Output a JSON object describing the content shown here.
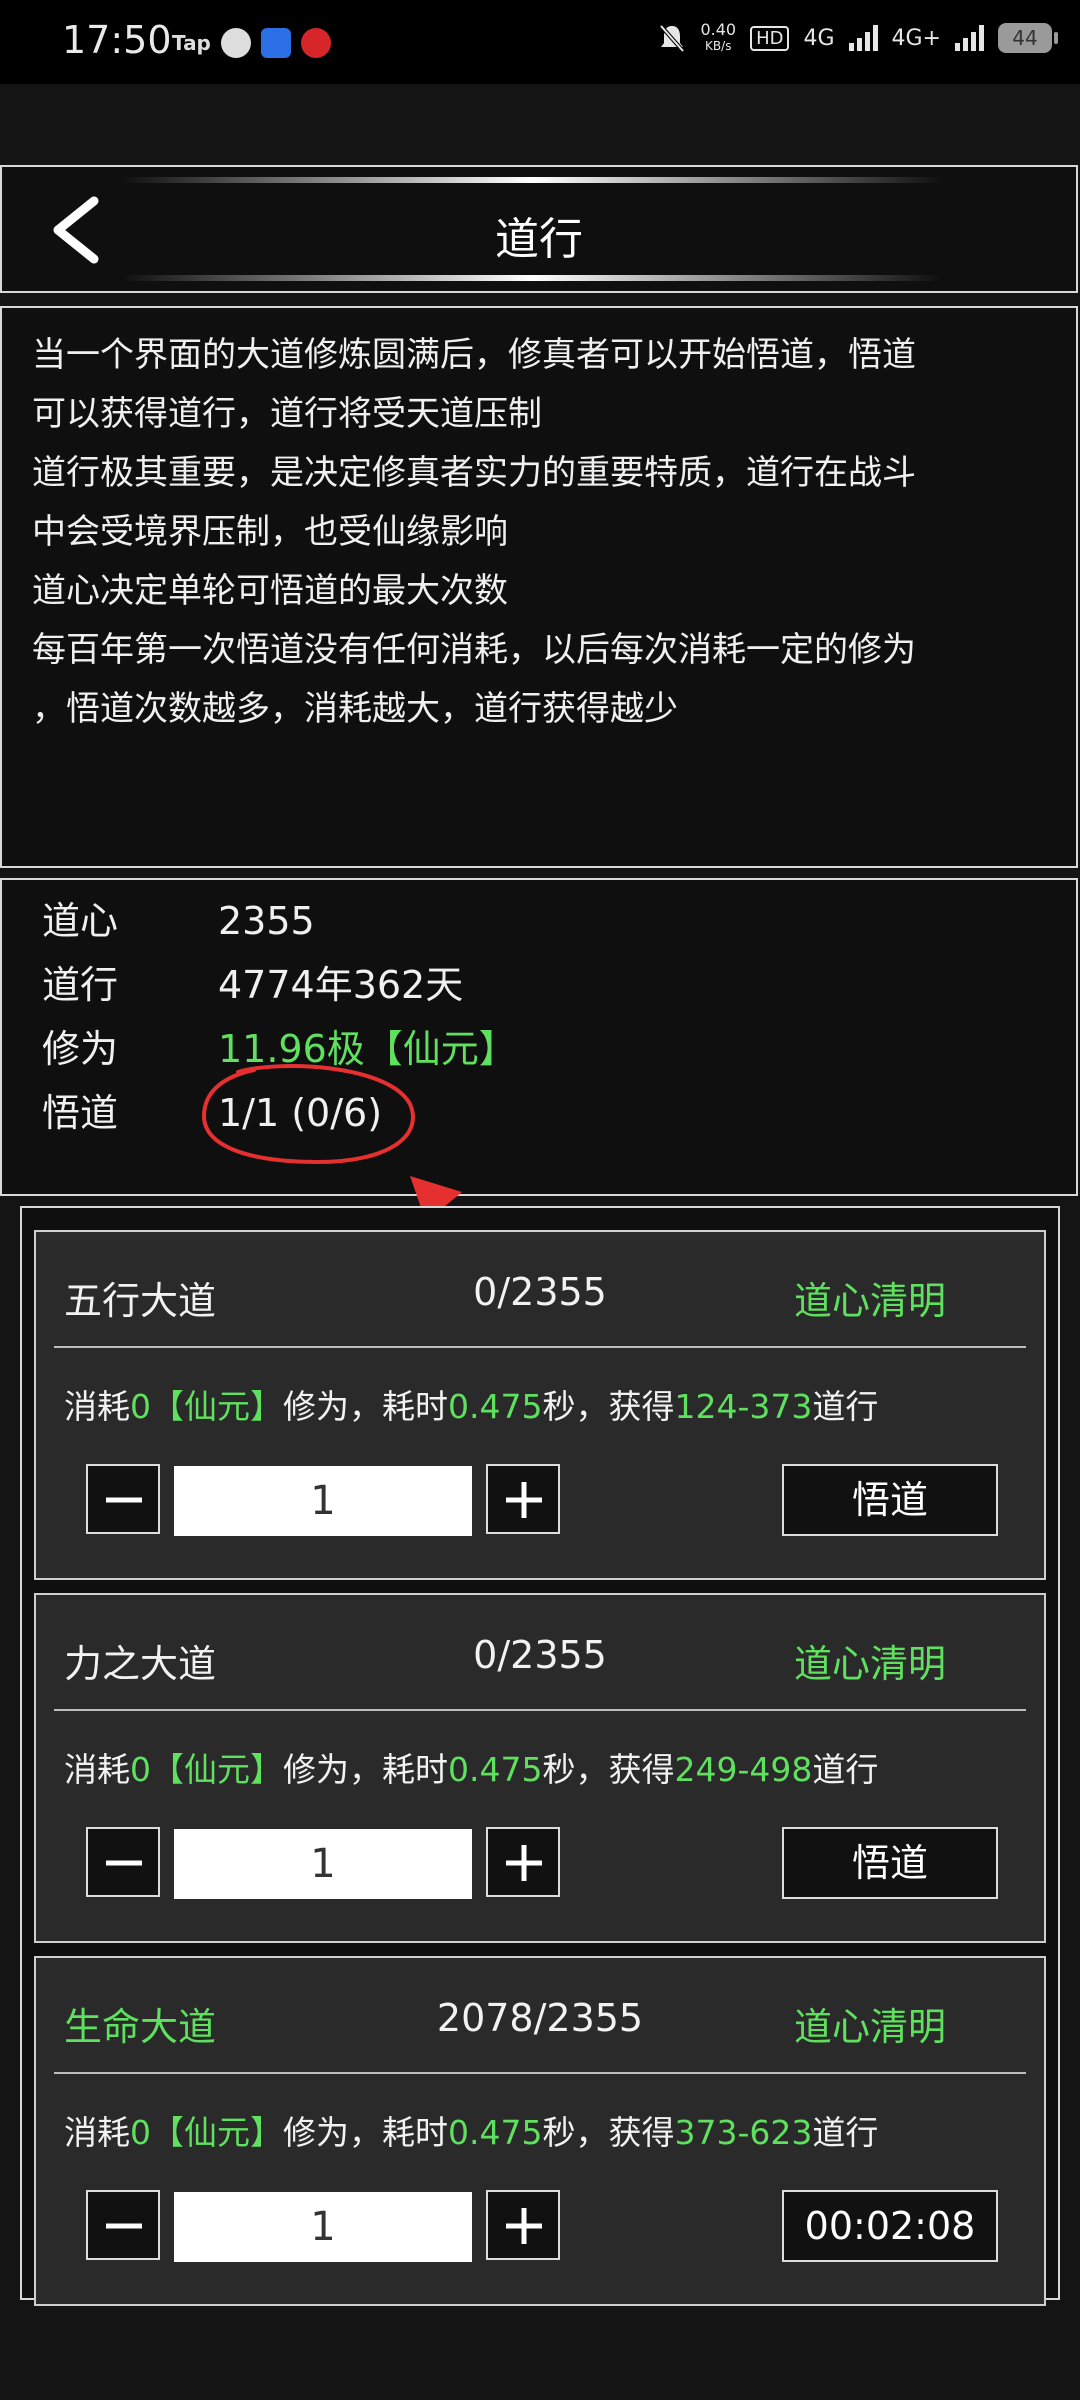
{
  "status_bar": {
    "time": "17:50",
    "notif_tap": "Tap",
    "speed_value": "0.40",
    "speed_unit": "KB/s",
    "hd": "HD",
    "net1": "4G",
    "net2": "4G+",
    "battery": "44"
  },
  "header": {
    "title": "道行"
  },
  "description": [
    "当一个界面的大道修炼圆满后，修真者可以开始悟道，悟道",
    "可以获得道行，道行将受天道压制",
    "道行极其重要，是决定修真者实力的重要特质，道行在战斗",
    "中会受境界压制，也受仙缘影响",
    "道心决定单轮可悟道的最大次数",
    "每百年第一次悟道没有任何消耗，以后每次消耗一定的修为",
    "，悟道次数越多，消耗越大，道行获得越少"
  ],
  "stats": {
    "daoxin_label": "道心",
    "daoxin_value": "2355",
    "daoxing_label": "道行",
    "daoxing_value": "4774年362天",
    "xiuwei_label": "修为",
    "xiuwei_value": "11.96极【仙元】",
    "wudao_label": "悟道",
    "wudao_value": "1/1 (0/6)"
  },
  "common": {
    "cost_prefix": "消耗",
    "cost_amount": "0",
    "cost_unit": "【仙元】",
    "cost_mid": "修为，耗时",
    "time_value": "0.475",
    "time_mid": "秒，获得",
    "gain_suffix": "道行",
    "status": "道心清明"
  },
  "cards": [
    {
      "name": "五行大道",
      "progress": "0/2355",
      "gain": "124-373",
      "qty": "1",
      "action": "悟道"
    },
    {
      "name": "力之大道",
      "progress": "0/2355",
      "gain": "249-498",
      "qty": "1",
      "action": "悟道"
    },
    {
      "name": "生命大道",
      "progress": "2078/2355",
      "gain": "373-623",
      "qty": "1",
      "action": "00:02:08"
    }
  ],
  "colors": {
    "accent_green": "#5fe05f",
    "annotation_red": "#e5302f",
    "background": "#141414"
  }
}
